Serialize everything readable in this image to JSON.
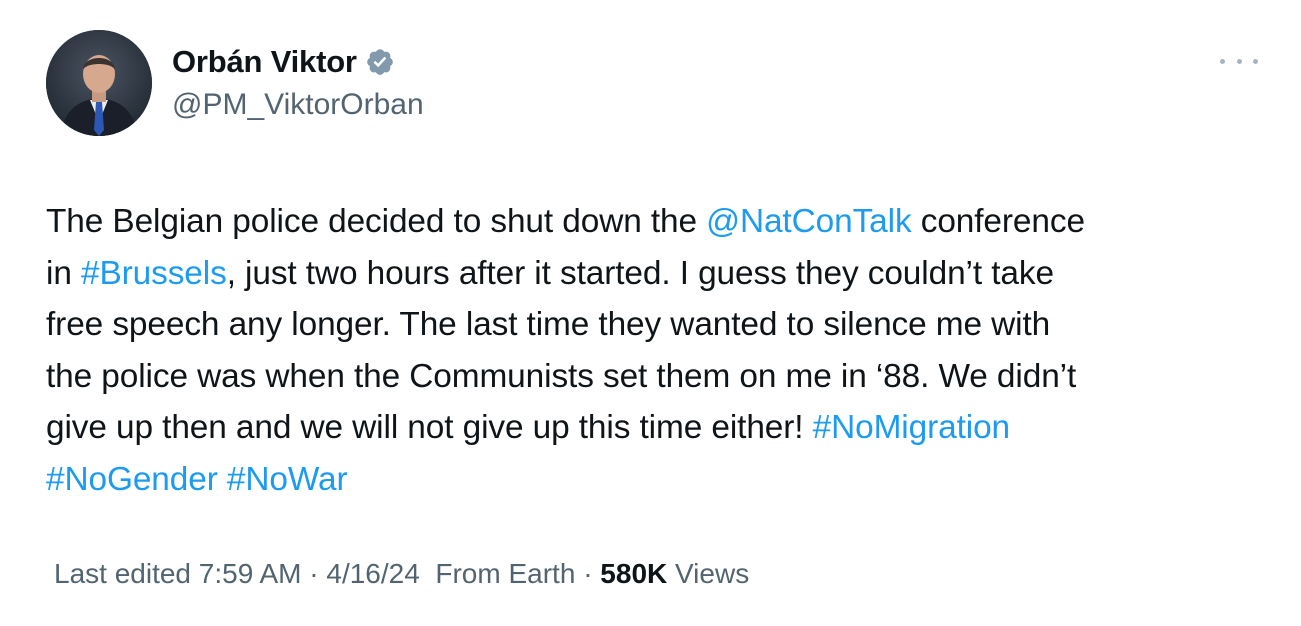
{
  "author": {
    "display_name": "Orbán Viktor",
    "handle": "@PM_ViktorOrban",
    "verified_icon": "verified-badge-icon",
    "avatar_icon": "profile-photo"
  },
  "tweet": {
    "lines": [
      [
        {
          "text": "The Belgian police decided to shut down the ",
          "type": "text"
        },
        {
          "text": "@NatConTalk",
          "type": "mention"
        },
        {
          "text": " conference",
          "type": "text"
        }
      ],
      [
        {
          "text": "in ",
          "type": "text"
        },
        {
          "text": "#Brussels",
          "type": "hashtag"
        },
        {
          "text": ", just two hours after it started. I guess they couldn’t take",
          "type": "text"
        }
      ],
      [
        {
          "text": "free speech any longer. The last time they wanted to silence me with",
          "type": "text"
        }
      ],
      [
        {
          "text": "the police was when the Communists set them on me in ‘88. We didn’t",
          "type": "text"
        }
      ],
      [
        {
          "text": "give up then and we will not give up this time either! ",
          "type": "text"
        },
        {
          "text": "#NoMigration",
          "type": "hashtag"
        }
      ],
      [
        {
          "text": "#NoGender",
          "type": "hashtag"
        },
        {
          "text": " ",
          "type": "text"
        },
        {
          "text": "#NoWar",
          "type": "hashtag"
        }
      ]
    ]
  },
  "meta": {
    "edited_label": "Last edited 7:59 AM · 4/16/24",
    "source": "From Earth",
    "separator": "·",
    "views_count": "580K",
    "views_label": "Views"
  },
  "colors": {
    "link": "#1d9bf0",
    "text": "#0f1419",
    "secondary": "#536471",
    "verified": "#829aab"
  },
  "icons": {
    "more": "more-horizontal-icon"
  }
}
